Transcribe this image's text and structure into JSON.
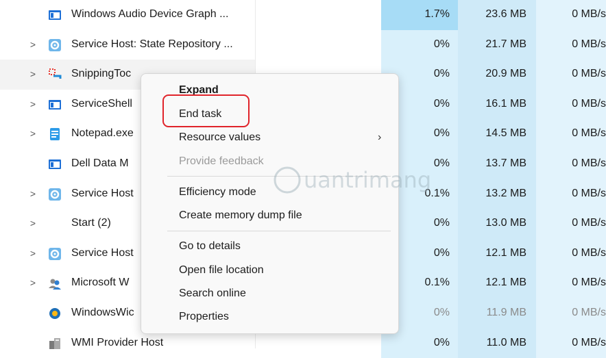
{
  "rows": [
    {
      "expander": "",
      "icon": "app-window-icon",
      "name": "Windows Audio Device Graph ...",
      "cpu": "1.7%",
      "memory": "23.6 MB",
      "disk": "0 MB/s",
      "dim": false
    },
    {
      "expander": ">",
      "icon": "gear-service-icon",
      "name": "Service Host: State Repository ...",
      "cpu": "0%",
      "memory": "21.7 MB",
      "disk": "0 MB/s",
      "dim": false
    },
    {
      "expander": ">",
      "icon": "snipping-tool-icon",
      "name": "SnippingToc",
      "cpu": "0%",
      "memory": "20.9 MB",
      "disk": "0 MB/s",
      "dim": false
    },
    {
      "expander": ">",
      "icon": "app-window-icon",
      "name": "ServiceShell",
      "cpu": "0%",
      "memory": "16.1 MB",
      "disk": "0 MB/s",
      "dim": false
    },
    {
      "expander": ">",
      "icon": "notepad-icon",
      "name": "Notepad.exe",
      "cpu": "0%",
      "memory": "14.5 MB",
      "disk": "0 MB/s",
      "dim": false
    },
    {
      "expander": "",
      "icon": "app-window-icon",
      "name": "Dell Data M",
      "cpu": "0%",
      "memory": "13.7 MB",
      "disk": "0 MB/s",
      "dim": false
    },
    {
      "expander": ">",
      "icon": "gear-service-icon",
      "name": "Service Host",
      "cpu": "0.1%",
      "memory": "13.2 MB",
      "disk": "0 MB/s",
      "dim": false
    },
    {
      "expander": ">",
      "icon": "",
      "name": "Start (2)",
      "cpu": "0%",
      "memory": "13.0 MB",
      "disk": "0 MB/s",
      "dim": false
    },
    {
      "expander": ">",
      "icon": "gear-service-icon",
      "name": "Service Host",
      "cpu": "0%",
      "memory": "12.1 MB",
      "disk": "0 MB/s",
      "dim": false
    },
    {
      "expander": ">",
      "icon": "users-icon",
      "name": "Microsoft W",
      "cpu": "0.1%",
      "memory": "12.1 MB",
      "disk": "0 MB/s",
      "dim": false
    },
    {
      "expander": "",
      "icon": "widgets-icon",
      "name": "WindowsWic",
      "cpu": "0%",
      "memory": "11.9 MB",
      "disk": "0 MB/s",
      "dim": true
    },
    {
      "expander": "",
      "icon": "wmi-icon",
      "name": "WMI Provider Host",
      "cpu": "0%",
      "memory": "11.0 MB",
      "disk": "0 MB/s",
      "dim": false
    }
  ],
  "context_menu": {
    "expand": "Expand",
    "end_task": "End task",
    "resource_values": "Resource values",
    "provide_feedback": "Provide feedback",
    "efficiency_mode": "Efficiency mode",
    "create_dump": "Create memory dump file",
    "go_to_details": "Go to details",
    "open_file_location": "Open file location",
    "search_online": "Search online",
    "properties": "Properties"
  },
  "watermark": "Quantrimang",
  "colors": {
    "cpu_highlight": "#a7dcf6",
    "cpu_bg": "#d9f0fb",
    "mem_bg": "#cfeaf8",
    "disk_bg": "#e2f3fc",
    "end_task_highlight": "#e0232a"
  }
}
